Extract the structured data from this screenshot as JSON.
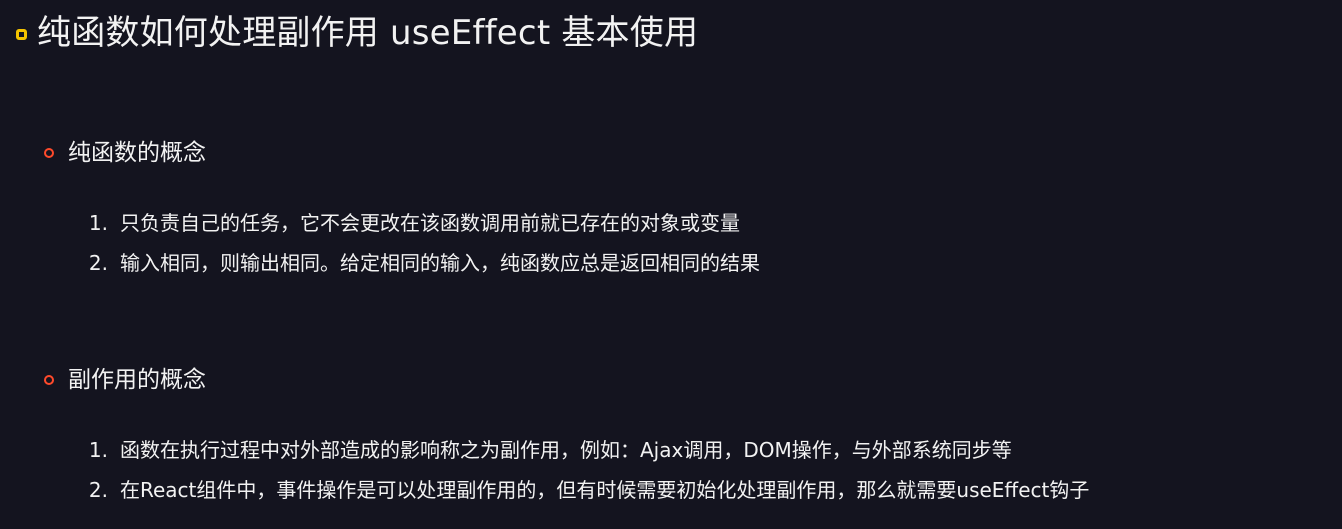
{
  "slide": {
    "title": "纯函数如何处理副作用 useEffect 基本使用",
    "accent_colors": {
      "title_bullet": "#f5c400",
      "section_bullet": "#ff4a2b",
      "background": "#14141f",
      "text": "#f2f2f2"
    }
  },
  "sections": [
    {
      "title": "纯函数的概念",
      "items": [
        {
          "num": "1.",
          "text": "只负责自己的任务，它不会更改在该函数调用前就已存在的对象或变量"
        },
        {
          "num": "2.",
          "text": "输入相同，则输出相同。给定相同的输入，纯函数应总是返回相同的结果"
        }
      ]
    },
    {
      "title": "副作用的概念",
      "items": [
        {
          "num": "1.",
          "text": "函数在执行过程中对外部造成的影响称之为副作用，例如：Ajax调用，DOM操作，与外部系统同步等"
        },
        {
          "num": "2.",
          "text": "在React组件中，事件操作是可以处理副作用的，但有时候需要初始化处理副作用，那么就需要useEffect钩子"
        }
      ]
    }
  ]
}
